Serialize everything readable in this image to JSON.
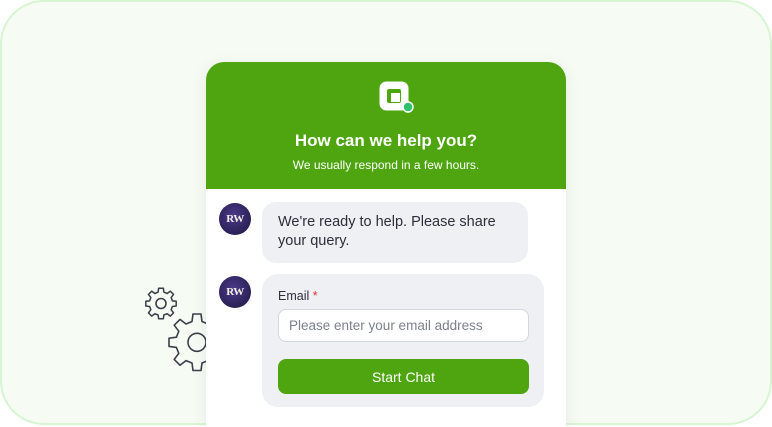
{
  "colors": {
    "accent": "#4ea50f",
    "frame_bg": "#f6fcf4",
    "frame_border": "#d7f5d1",
    "bubble_bg": "#eff0f4",
    "status_dot": "#2fc06a"
  },
  "icons": {
    "logo": "square-chat-logo-icon",
    "status": "online-dot-icon",
    "decoration": "gears-icon"
  },
  "header": {
    "title": "How can we help you?",
    "subtitle": "We usually respond in a few hours."
  },
  "agent": {
    "avatar_initials": "RW"
  },
  "messages": [
    {
      "text": "We're ready to help. Please share your query."
    }
  ],
  "form": {
    "email_label": "Email",
    "required_mark": "*",
    "email_placeholder": "Please enter your email address",
    "email_value": "",
    "submit_label": "Start Chat"
  }
}
